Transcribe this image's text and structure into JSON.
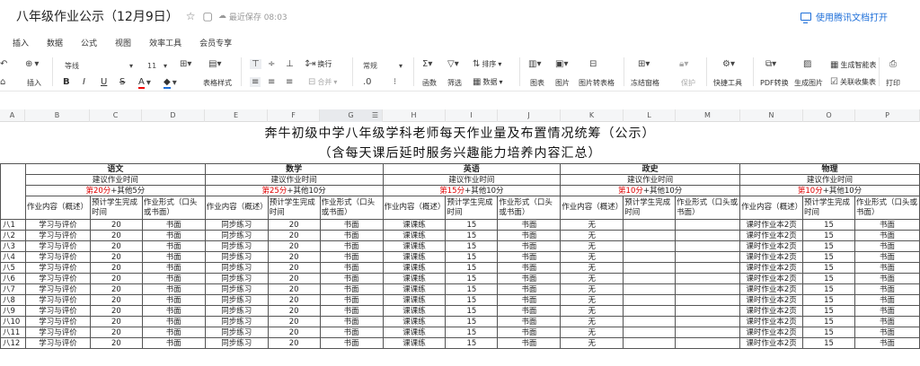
{
  "title": "八年级作业公示（12月9日）",
  "save_status": "最近保存 08:03",
  "open_in_tencent": "使用腾讯文档打开",
  "menu": [
    "插入",
    "数据",
    "公式",
    "视图",
    "效率工具",
    "会员专享"
  ],
  "toolbar": {
    "insert": "插入",
    "font": "等线",
    "size": "11",
    "table_style": "表格样式",
    "wrap": "换行",
    "merge": "合并",
    "format": "常规",
    "sum": "函数",
    "filter": "筛选",
    "sort": "排序",
    "data": "数据",
    "chart": "图表",
    "image": "图片",
    "image_to_table": "图片转表格",
    "freeze": "冻结窗格",
    "protect": "保护",
    "quick_tools": "快捷工具",
    "pdf": "PDF转换",
    "gen_image": "生成图片",
    "smart_table": "生成智能表",
    "link_form": "关联收集表",
    "print": "打印"
  },
  "columns": [
    "A",
    "B",
    "C",
    "D",
    "E",
    "F",
    "G",
    "H",
    "I",
    "J",
    "K",
    "L",
    "M",
    "N",
    "O",
    "P"
  ],
  "sheet": {
    "heading1": "奔牛初级中学八年级学科老师每天作业量及布置情况统筹（公示）",
    "heading2": "（含每天课后延时服务兴趣能力培养内容汇总）",
    "subjects": [
      {
        "name": "语文",
        "suggest": "建议作业时间",
        "time_red": "第20分",
        "time_rest": "+其他5分"
      },
      {
        "name": "数学",
        "suggest": "建议作业时间",
        "time_red": "第25分",
        "time_rest": "+其他10分"
      },
      {
        "name": "英语",
        "suggest": "建议作业时间",
        "time_red": "第15分",
        "time_rest": "+其他10分"
      },
      {
        "name": "政史",
        "suggest": "建议作业时间",
        "time_red": "第10分",
        "time_rest": "+其他10分"
      },
      {
        "name": "物理",
        "suggest": "建议作业时间",
        "time_red": "第10分",
        "time_rest": "+其他10分"
      }
    ],
    "sub_headers": [
      "作业内容（概述）",
      "预计学生完成时间",
      "作业形式（口头或书面）"
    ],
    "rows": [
      {
        "cls": "八1",
        "c": [
          "学习与评价",
          "20",
          "书面",
          "同步练习",
          "20",
          "书面",
          "课课练",
          "15",
          "书面",
          "无",
          "",
          "",
          "课时作业本2页",
          "15",
          "书面"
        ]
      },
      {
        "cls": "八2",
        "c": [
          "学习与评价",
          "20",
          "书面",
          "同步练习",
          "20",
          "书面",
          "课课练",
          "15",
          "书面",
          "无",
          "",
          "",
          "课时作业本2页",
          "15",
          "书面"
        ]
      },
      {
        "cls": "八3",
        "c": [
          "学习与评价",
          "20",
          "书面",
          "同步练习",
          "20",
          "书面",
          "课课练",
          "15",
          "书面",
          "无",
          "",
          "",
          "课时作业本2页",
          "15",
          "书面"
        ]
      },
      {
        "cls": "八4",
        "c": [
          "学习与评价",
          "20",
          "书面",
          "同步练习",
          "20",
          "书面",
          "课课练",
          "15",
          "书面",
          "无",
          "",
          "",
          "课时作业本2页",
          "15",
          "书面"
        ]
      },
      {
        "cls": "八5",
        "c": [
          "学习与评价",
          "20",
          "书面",
          "同步练习",
          "20",
          "书面",
          "课课练",
          "15",
          "书面",
          "无",
          "",
          "",
          "课时作业本2页",
          "15",
          "书面"
        ]
      },
      {
        "cls": "八6",
        "c": [
          "学习与评价",
          "20",
          "书面",
          "同步练习",
          "20",
          "书面",
          "课课练",
          "15",
          "书面",
          "无",
          "",
          "",
          "课时作业本2页",
          "15",
          "书面"
        ]
      },
      {
        "cls": "八7",
        "c": [
          "学习与评价",
          "20",
          "书面",
          "同步练习",
          "20",
          "书面",
          "课课练",
          "15",
          "书面",
          "无",
          "",
          "",
          "课时作业本2页",
          "15",
          "书面"
        ]
      },
      {
        "cls": "八8",
        "c": [
          "学习与评价",
          "20",
          "书面",
          "同步练习",
          "20",
          "书面",
          "课课练",
          "15",
          "书面",
          "无",
          "",
          "",
          "课时作业本2页",
          "15",
          "书面"
        ]
      },
      {
        "cls": "八9",
        "c": [
          "学习与评价",
          "20",
          "书面",
          "同步练习",
          "20",
          "书面",
          "课课练",
          "15",
          "书面",
          "无",
          "",
          "",
          "课时作业本2页",
          "15",
          "书面"
        ]
      },
      {
        "cls": "八10",
        "c": [
          "学习与评价",
          "20",
          "书面",
          "同步练习",
          "20",
          "书面",
          "课课练",
          "15",
          "书面",
          "无",
          "",
          "",
          "课时作业本2页",
          "15",
          "书面"
        ]
      },
      {
        "cls": "八11",
        "c": [
          "学习与评价",
          "20",
          "书面",
          "同步练习",
          "20",
          "书面",
          "课课练",
          "15",
          "书面",
          "无",
          "",
          "",
          "课时作业本2页",
          "15",
          "书面"
        ]
      },
      {
        "cls": "八12",
        "c": [
          "学习与评价",
          "20",
          "书面",
          "同步练习",
          "20",
          "书面",
          "课课练",
          "15",
          "书面",
          "无",
          "",
          "",
          "课时作业本2页",
          "15",
          "书面"
        ]
      }
    ]
  }
}
